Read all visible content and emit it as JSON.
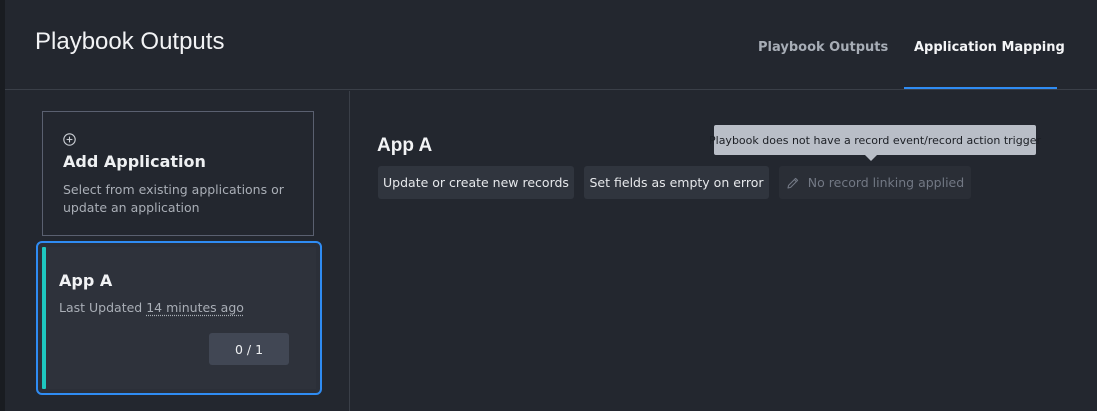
{
  "header": {
    "title": "Playbook Outputs",
    "tabs": [
      {
        "label": "Playbook Outputs",
        "active": false
      },
      {
        "label": "Application Mapping",
        "active": true
      }
    ]
  },
  "sidebar": {
    "add_application": {
      "icon": "plus-circle-icon",
      "title": "Add Application",
      "description": "Select from existing applications or update an application"
    },
    "applications": [
      {
        "name": "App A",
        "updated_prefix": "Last Updated",
        "updated_ago": "14 minutes ago",
        "count": "0 / 1",
        "selected": true
      }
    ]
  },
  "main": {
    "title": "App A",
    "options": [
      {
        "label": "Update or create new records"
      },
      {
        "label": "Set fields as empty on error"
      },
      {
        "label": "No record linking applied",
        "icon": "pencil-icon",
        "disabled": true
      }
    ],
    "tooltip": "Playbook does not have a record event/record action trigger"
  },
  "colors": {
    "background": "#23272f",
    "accent_blue": "#2f8cf3",
    "accent_teal": "#1ec8c0",
    "tooltip_bg": "#b9bec7"
  }
}
